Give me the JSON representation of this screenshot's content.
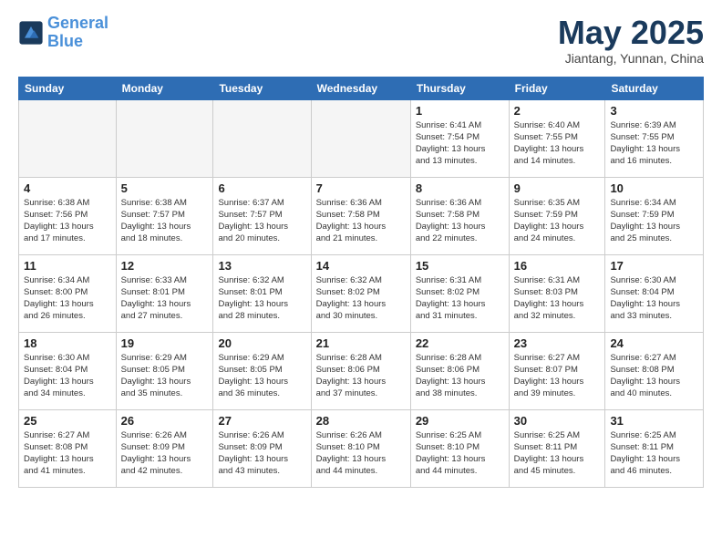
{
  "header": {
    "logo_line1": "General",
    "logo_line2": "Blue",
    "month": "May 2025",
    "location": "Jiantang, Yunnan, China"
  },
  "weekdays": [
    "Sunday",
    "Monday",
    "Tuesday",
    "Wednesday",
    "Thursday",
    "Friday",
    "Saturday"
  ],
  "weeks": [
    [
      {
        "day": "",
        "info": ""
      },
      {
        "day": "",
        "info": ""
      },
      {
        "day": "",
        "info": ""
      },
      {
        "day": "",
        "info": ""
      },
      {
        "day": "1",
        "info": "Sunrise: 6:41 AM\nSunset: 7:54 PM\nDaylight: 13 hours\nand 13 minutes."
      },
      {
        "day": "2",
        "info": "Sunrise: 6:40 AM\nSunset: 7:55 PM\nDaylight: 13 hours\nand 14 minutes."
      },
      {
        "day": "3",
        "info": "Sunrise: 6:39 AM\nSunset: 7:55 PM\nDaylight: 13 hours\nand 16 minutes."
      }
    ],
    [
      {
        "day": "4",
        "info": "Sunrise: 6:38 AM\nSunset: 7:56 PM\nDaylight: 13 hours\nand 17 minutes."
      },
      {
        "day": "5",
        "info": "Sunrise: 6:38 AM\nSunset: 7:57 PM\nDaylight: 13 hours\nand 18 minutes."
      },
      {
        "day": "6",
        "info": "Sunrise: 6:37 AM\nSunset: 7:57 PM\nDaylight: 13 hours\nand 20 minutes."
      },
      {
        "day": "7",
        "info": "Sunrise: 6:36 AM\nSunset: 7:58 PM\nDaylight: 13 hours\nand 21 minutes."
      },
      {
        "day": "8",
        "info": "Sunrise: 6:36 AM\nSunset: 7:58 PM\nDaylight: 13 hours\nand 22 minutes."
      },
      {
        "day": "9",
        "info": "Sunrise: 6:35 AM\nSunset: 7:59 PM\nDaylight: 13 hours\nand 24 minutes."
      },
      {
        "day": "10",
        "info": "Sunrise: 6:34 AM\nSunset: 7:59 PM\nDaylight: 13 hours\nand 25 minutes."
      }
    ],
    [
      {
        "day": "11",
        "info": "Sunrise: 6:34 AM\nSunset: 8:00 PM\nDaylight: 13 hours\nand 26 minutes."
      },
      {
        "day": "12",
        "info": "Sunrise: 6:33 AM\nSunset: 8:01 PM\nDaylight: 13 hours\nand 27 minutes."
      },
      {
        "day": "13",
        "info": "Sunrise: 6:32 AM\nSunset: 8:01 PM\nDaylight: 13 hours\nand 28 minutes."
      },
      {
        "day": "14",
        "info": "Sunrise: 6:32 AM\nSunset: 8:02 PM\nDaylight: 13 hours\nand 30 minutes."
      },
      {
        "day": "15",
        "info": "Sunrise: 6:31 AM\nSunset: 8:02 PM\nDaylight: 13 hours\nand 31 minutes."
      },
      {
        "day": "16",
        "info": "Sunrise: 6:31 AM\nSunset: 8:03 PM\nDaylight: 13 hours\nand 32 minutes."
      },
      {
        "day": "17",
        "info": "Sunrise: 6:30 AM\nSunset: 8:04 PM\nDaylight: 13 hours\nand 33 minutes."
      }
    ],
    [
      {
        "day": "18",
        "info": "Sunrise: 6:30 AM\nSunset: 8:04 PM\nDaylight: 13 hours\nand 34 minutes."
      },
      {
        "day": "19",
        "info": "Sunrise: 6:29 AM\nSunset: 8:05 PM\nDaylight: 13 hours\nand 35 minutes."
      },
      {
        "day": "20",
        "info": "Sunrise: 6:29 AM\nSunset: 8:05 PM\nDaylight: 13 hours\nand 36 minutes."
      },
      {
        "day": "21",
        "info": "Sunrise: 6:28 AM\nSunset: 8:06 PM\nDaylight: 13 hours\nand 37 minutes."
      },
      {
        "day": "22",
        "info": "Sunrise: 6:28 AM\nSunset: 8:06 PM\nDaylight: 13 hours\nand 38 minutes."
      },
      {
        "day": "23",
        "info": "Sunrise: 6:27 AM\nSunset: 8:07 PM\nDaylight: 13 hours\nand 39 minutes."
      },
      {
        "day": "24",
        "info": "Sunrise: 6:27 AM\nSunset: 8:08 PM\nDaylight: 13 hours\nand 40 minutes."
      }
    ],
    [
      {
        "day": "25",
        "info": "Sunrise: 6:27 AM\nSunset: 8:08 PM\nDaylight: 13 hours\nand 41 minutes."
      },
      {
        "day": "26",
        "info": "Sunrise: 6:26 AM\nSunset: 8:09 PM\nDaylight: 13 hours\nand 42 minutes."
      },
      {
        "day": "27",
        "info": "Sunrise: 6:26 AM\nSunset: 8:09 PM\nDaylight: 13 hours\nand 43 minutes."
      },
      {
        "day": "28",
        "info": "Sunrise: 6:26 AM\nSunset: 8:10 PM\nDaylight: 13 hours\nand 44 minutes."
      },
      {
        "day": "29",
        "info": "Sunrise: 6:25 AM\nSunset: 8:10 PM\nDaylight: 13 hours\nand 44 minutes."
      },
      {
        "day": "30",
        "info": "Sunrise: 6:25 AM\nSunset: 8:11 PM\nDaylight: 13 hours\nand 45 minutes."
      },
      {
        "day": "31",
        "info": "Sunrise: 6:25 AM\nSunset: 8:11 PM\nDaylight: 13 hours\nand 46 minutes."
      }
    ]
  ]
}
